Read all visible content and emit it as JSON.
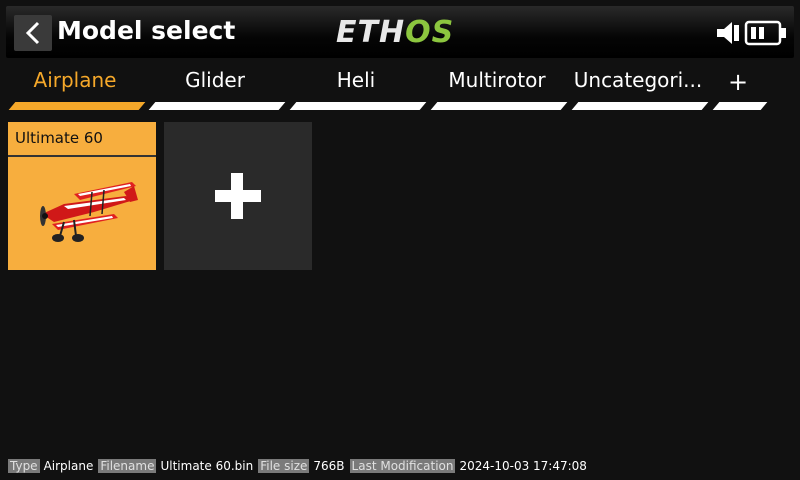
{
  "header": {
    "title": "Model select",
    "logo_part1": "ETH",
    "logo_part2": "OS",
    "back_icon": "chevron-left-icon",
    "speaker_icon": "speaker-icon",
    "battery_icon": "battery-icon"
  },
  "tabs": [
    {
      "label": "Airplane",
      "active": true
    },
    {
      "label": "Glider"
    },
    {
      "label": "Heli"
    },
    {
      "label": "Multirotor"
    },
    {
      "label": "Uncategori..."
    },
    {
      "label": "+"
    }
  ],
  "models": [
    {
      "name": "Ultimate 60",
      "image": "airplane-biplane"
    }
  ],
  "add_tile_icon": "plus-icon",
  "footer": {
    "type_key": "Type",
    "type_value": "Airplane",
    "filename_key": "Filename",
    "filename_value": "Ultimate 60.bin",
    "filesize_key": "File size",
    "filesize_value": "766B",
    "lastmod_key": "Last Modification",
    "lastmod_value": "2024-10-03 17:47:08"
  },
  "colors": {
    "accent": "#f5a82a",
    "logo_green": "#8cc63f",
    "background": "#111111",
    "tile_empty": "#2a2a2a"
  }
}
